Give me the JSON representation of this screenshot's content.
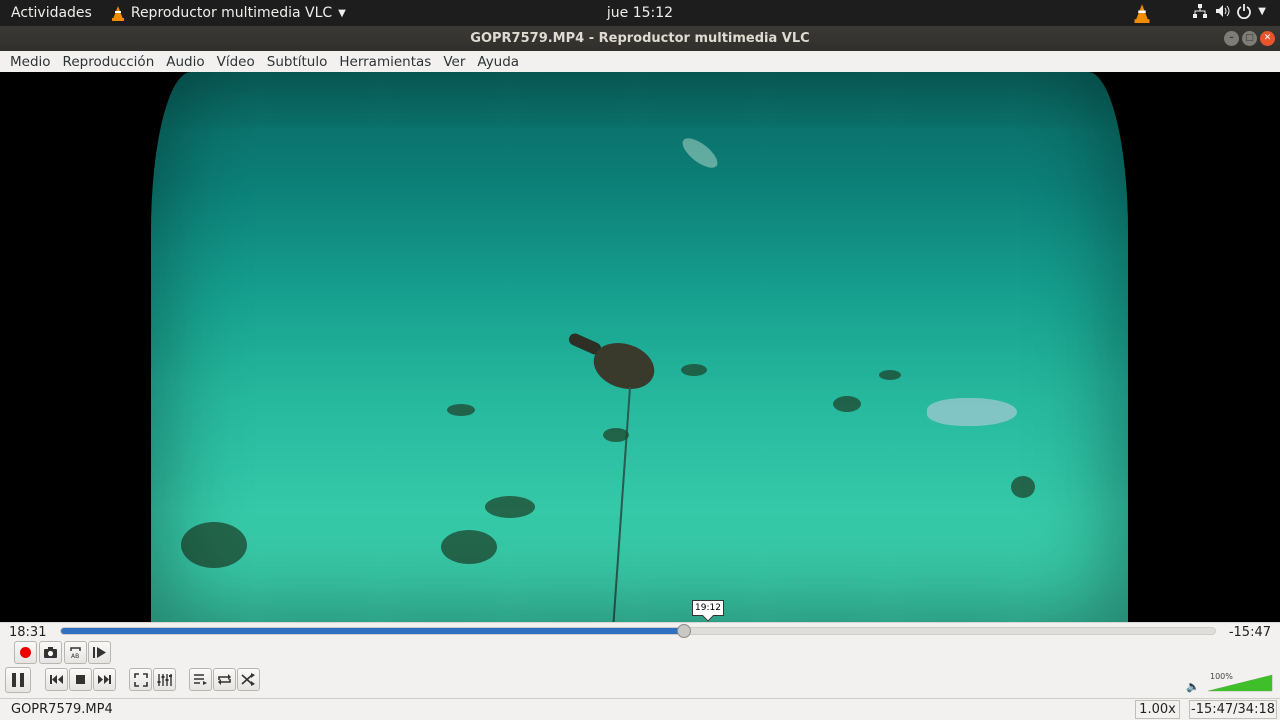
{
  "topbar": {
    "activities": "Actividades",
    "app_name": "Reproductor multimedia VLC",
    "clock": "jue 15:12"
  },
  "window": {
    "title": "GOPR7579.MP4 - Reproductor multimedia VLC"
  },
  "menu": {
    "items": [
      "Medio",
      "Reproducción",
      "Audio",
      "Vídeo",
      "Subtítulo",
      "Herramientas",
      "Ver",
      "Ayuda"
    ]
  },
  "player": {
    "elapsed": "18:31",
    "remaining": "-15:47",
    "hover_time": "19:12",
    "progress": 0.54,
    "volume_label": "100%",
    "volume": 1.0
  },
  "status": {
    "filename": "GOPR7579.MP4",
    "rate": "1.00x",
    "time_total": "-15:47/34:18"
  },
  "colors": {
    "accent": "#2f6fbf",
    "record": "#ee0000",
    "vlc_orange": "#f08c00"
  }
}
